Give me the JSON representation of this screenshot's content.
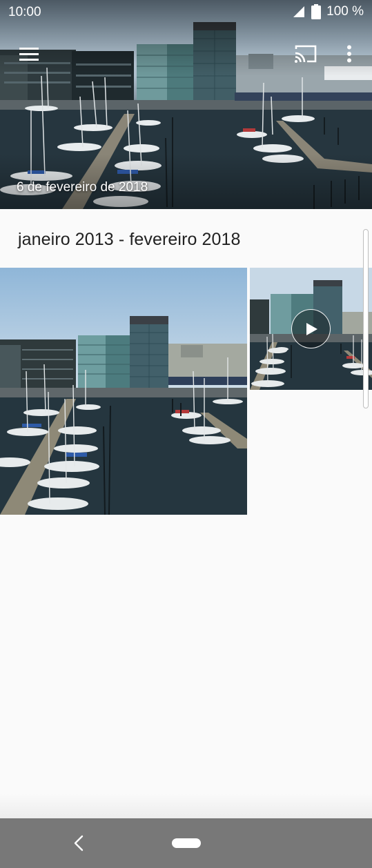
{
  "status_bar": {
    "time": "10:00",
    "battery_text": "100 %",
    "icons": [
      "signal-icon",
      "battery-icon"
    ]
  },
  "toolbar": {
    "menu_icon": "hamburger-menu-icon",
    "cast_icon": "cast-icon",
    "more_icon": "more-vert-icon"
  },
  "hero": {
    "date": "6 de fevereiro de 2018"
  },
  "gallery": {
    "range_title": "janeiro 2013 - fevereiro 2018",
    "items": [
      {
        "type": "photo"
      },
      {
        "type": "video",
        "overlay_icon": "play-icon"
      }
    ]
  },
  "nav_bar": {
    "back_icon": "back-chevron-icon",
    "home_icon": "home-pill-icon"
  },
  "colors": {
    "text_primary": "#212121",
    "background": "#fafafa",
    "nav_bar": "#787878",
    "water": "#22323b",
    "sky": "#c4d6e4"
  }
}
